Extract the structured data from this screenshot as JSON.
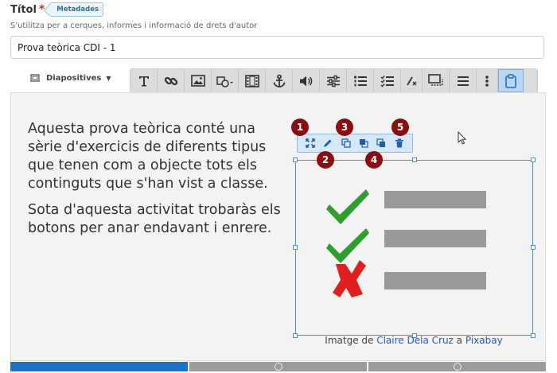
{
  "form": {
    "title_label": "Títol",
    "required_mark": "*",
    "metadata_badge": "Metadades",
    "help_text": "S'utilitza per a cerques, informes i informació de drets d'autor",
    "title_value": "Prova teòrica CDI - 1"
  },
  "editor": {
    "content_type_label": "Diapositives",
    "toolbar_icons": [
      "text-icon",
      "link-icon",
      "image-icon",
      "shapes-icon",
      "video-icon",
      "anchor-icon",
      "audio-icon",
      "slider-icon",
      "ordered-list-icon",
      "checklist-icon",
      "clear-format-icon",
      "overlay-icon",
      "list-icon",
      "more-icon",
      "paste-icon"
    ],
    "paragraphs": [
      "Aquesta prova teòrica conté una sèrie d'exercicis de diferents tipus que tenen com a objecte tots els continguts que s'han vist a classe.",
      "Sota d'aquesta activitat trobaràs els botons per anar endavant i enrere."
    ],
    "image_toolbar_icons": [
      "expand-icon",
      "edit-icon",
      "duplicate-icon",
      "send-back-icon",
      "bring-front-icon",
      "delete-icon"
    ],
    "markers": [
      "1",
      "2",
      "3",
      "4",
      "5"
    ],
    "caption": {
      "prefix": "Imatge de",
      "author": "Claire Dela Cruz",
      "joiner": "a",
      "site": "Pixabay"
    }
  },
  "progress": {
    "segments": 3,
    "current": 1
  },
  "colors": {
    "accent": "#1a73c9",
    "marker": "#8b0e0e",
    "check": "#2f9e2f",
    "cross": "#e02020"
  }
}
